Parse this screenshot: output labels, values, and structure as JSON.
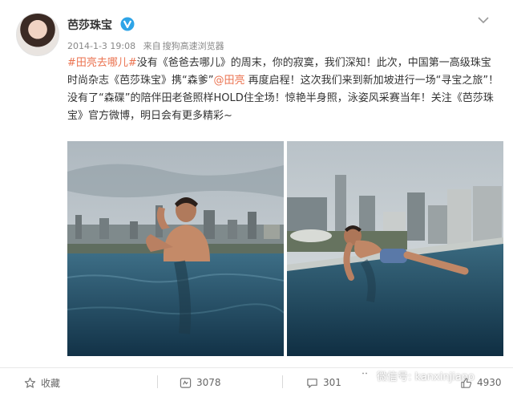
{
  "post": {
    "author": "芭莎珠宝",
    "timestamp": "2014-1-3 19:08",
    "source_prefix": "来自",
    "source": "搜狗高速浏览器",
    "text": {
      "hashtag": "#田亮去哪儿#",
      "part1": "没有《爸爸去哪儿》的周末，你的寂寞，我们深知！此次，中国第一高级珠宝时尚杂志《芭莎珠宝》携“森爹”",
      "mention": "@田亮",
      "part2": " 再度启程！这次我们来到新加坡进行一场“寻宝之旅”！没有了“森碟”的陪伴田老爸照样HOLD住全场！惊艳半身照，泳姿风采赛当年！关注《芭莎珠宝》官方微博，明日会有更多精彩~"
    }
  },
  "actions": {
    "favorite_label": "收藏",
    "repost_count": "3078",
    "comment_count": "301",
    "like_count": "4930"
  },
  "watermark": "微信号: kanxinjiapo",
  "colors": {
    "link": "#eb7350",
    "verified": "#2ea4e7"
  }
}
